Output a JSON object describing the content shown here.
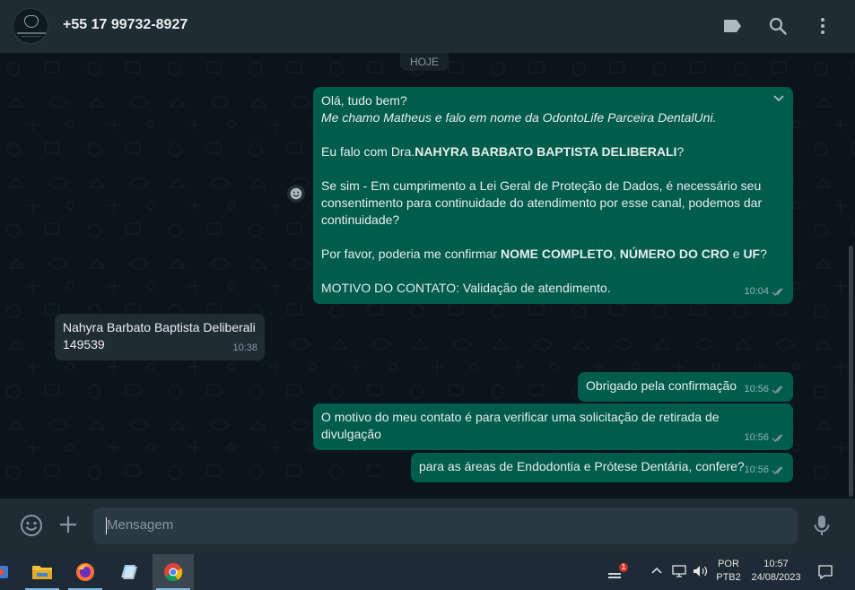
{
  "header": {
    "contact_name": "+55 17 99732-8927",
    "icons": [
      "label-icon",
      "search-icon",
      "menu-icon"
    ]
  },
  "chat": {
    "day_chip": "HOJE",
    "messages": [
      {
        "direction": "out",
        "time": "10:04",
        "status": "read",
        "lines": [
          {
            "parts": [
              {
                "t": "Olá, tudo bem?"
              }
            ]
          },
          {
            "parts": [
              {
                "t": "Me chamo Matheus e falo em nome da OdontoLife Parceira DentalUni.",
                "i": true
              }
            ]
          },
          {
            "parts": [
              {
                "t": ""
              }
            ]
          },
          {
            "parts": [
              {
                "t": "Eu falo com Dra."
              },
              {
                "t": "NAHYRA BARBATO BAPTISTA DELIBERALI",
                "b": true
              },
              {
                "t": "?"
              }
            ]
          },
          {
            "parts": [
              {
                "t": ""
              }
            ]
          },
          {
            "parts": [
              {
                "t": "Se sim - Em cumprimento a Lei Geral de Proteção de Dados, é necessário seu"
              }
            ]
          },
          {
            "parts": [
              {
                "t": "consentimento para continuidade do atendimento por esse canal, podemos dar"
              }
            ]
          },
          {
            "parts": [
              {
                "t": "continuidade?"
              }
            ]
          },
          {
            "parts": [
              {
                "t": ""
              }
            ]
          },
          {
            "parts": [
              {
                "t": "Por favor, poderia me confirmar "
              },
              {
                "t": "NOME COMPLETO",
                "b": true
              },
              {
                "t": ", "
              },
              {
                "t": "NÚMERO DO CRO",
                "b": true
              },
              {
                "t": " e "
              },
              {
                "t": "UF",
                "b": true
              },
              {
                "t": "?"
              }
            ]
          },
          {
            "parts": [
              {
                "t": ""
              }
            ]
          },
          {
            "parts": [
              {
                "t": "MOTIVO DO CONTATO: Validação de atendimento."
              }
            ]
          }
        ]
      },
      {
        "direction": "in",
        "time": "10:38",
        "lines": [
          {
            "parts": [
              {
                "t": "Nahyra Barbato Baptista Deliberali"
              }
            ]
          },
          {
            "parts": [
              {
                "t": "149539"
              }
            ]
          }
        ]
      },
      {
        "direction": "out",
        "time": "10:56",
        "status": "read",
        "lines": [
          {
            "parts": [
              {
                "t": "Obrigado pela confirmação"
              }
            ]
          }
        ]
      },
      {
        "direction": "out",
        "time": "10:56",
        "status": "read",
        "lines": [
          {
            "parts": [
              {
                "t": "O motivo do meu contato é para verificar uma solicitação de retirada de"
              }
            ]
          },
          {
            "parts": [
              {
                "t": "divulgação"
              }
            ]
          }
        ]
      },
      {
        "direction": "out",
        "time": "10:56",
        "status": "read",
        "lines": [
          {
            "parts": [
              {
                "t": "para as áreas de Endodontia e Prótese Dentária, confere?"
              }
            ]
          }
        ]
      }
    ]
  },
  "composer": {
    "placeholder": "Mensagem",
    "icons": [
      "emoji-icon",
      "plus-icon",
      "microphone-icon"
    ]
  },
  "taskbar": {
    "apps": [
      "app-icon",
      "file-explorer-icon",
      "firefox-icon",
      "notepad-icon",
      "chrome-icon"
    ],
    "notification_badge": "1",
    "language": "POR",
    "keyboard": "PTB2",
    "time": "10:57",
    "date": "24/08/2023"
  },
  "colors": {
    "outgoing_bubble": "#005c4b",
    "incoming_bubble": "#202c33",
    "header": "#202c33",
    "chat_background": "#0b141a"
  }
}
